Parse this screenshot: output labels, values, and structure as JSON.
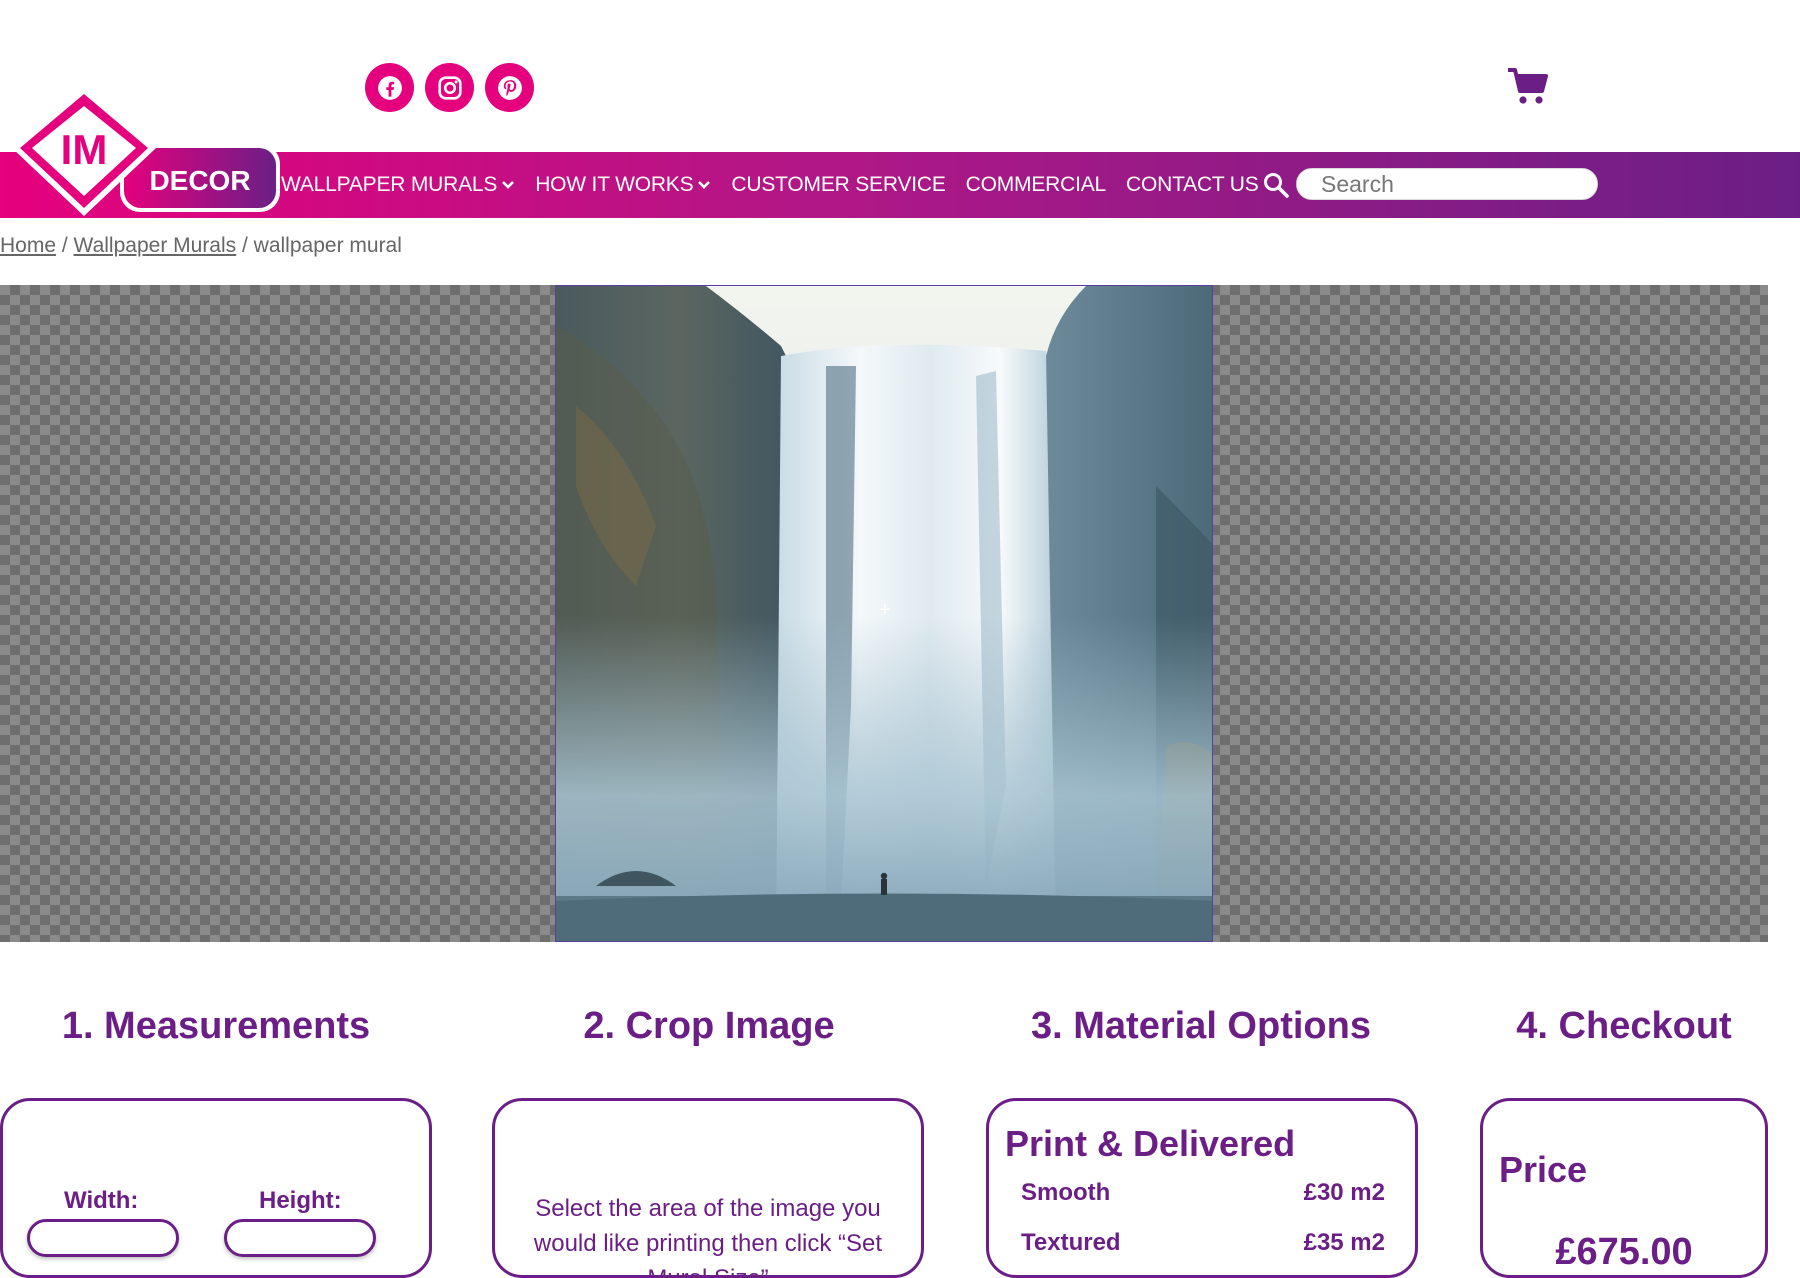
{
  "brand": {
    "logo_im": "IM",
    "logo_decor": "DECOR",
    "pink": "#e5007d",
    "purple": "#6b1f86"
  },
  "social": [
    {
      "icon": "facebook-icon"
    },
    {
      "icon": "instagram-icon"
    },
    {
      "icon": "pinterest-icon"
    }
  ],
  "header": {
    "cart_icon": "cart-icon"
  },
  "nav": {
    "items": [
      {
        "label": "WALLPAPER MURALS",
        "dropdown": true
      },
      {
        "label": "HOW IT WORKS",
        "dropdown": true
      },
      {
        "label": "CUSTOMER SERVICE",
        "dropdown": false
      },
      {
        "label": "COMMERCIAL",
        "dropdown": false
      },
      {
        "label": "CONTACT US",
        "dropdown": false
      }
    ],
    "search_placeholder": "Search"
  },
  "breadcrumb": {
    "home": "Home",
    "sep1": " / ",
    "category": "Wallpaper Murals",
    "sep2": " / ",
    "current": "wallpaper mural"
  },
  "viewer": {
    "crosshair": "+"
  },
  "steps": {
    "measurements": {
      "title": "1. Measurements",
      "width_label": "Width:",
      "height_label": "Height:",
      "width_value": "",
      "height_value": ""
    },
    "crop": {
      "title": "2. Crop Image",
      "text": "Select the area of the image you would like printing then click “Set Mural Size”"
    },
    "material": {
      "title": "3. Material Options",
      "heading": "Print & Delivered",
      "options": [
        {
          "name": "Smooth",
          "price": "£30 m2"
        },
        {
          "name": "Textured",
          "price": "£35 m2"
        }
      ]
    },
    "checkout": {
      "title": "4. Checkout",
      "price_label": "Price",
      "price_value": "£675.00"
    }
  }
}
